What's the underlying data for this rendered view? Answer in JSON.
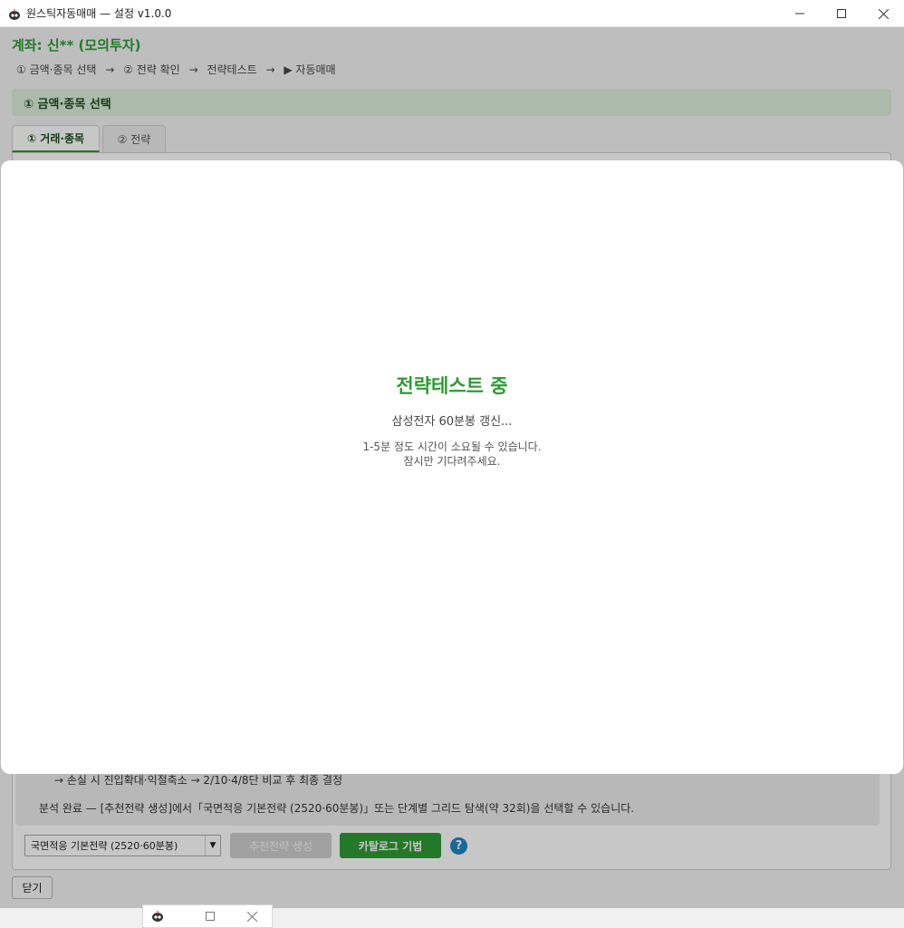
{
  "window": {
    "title": "원스틱자동매매 — 설정 v1.0.0"
  },
  "header": {
    "account": "계좌: 신** (모의투자)",
    "steps": [
      "① 금액·종목 선택",
      "→",
      "② 전략 확인",
      "→",
      "전략테스트",
      "→",
      "▶ 자동매매"
    ]
  },
  "section": {
    "title": "① 금액·종목 선택"
  },
  "tabs": [
    {
      "label": "① 거래·종목",
      "active": true
    },
    {
      "label": "② 전략",
      "active": false
    }
  ],
  "panel": {
    "info_line_1": "→ 손실 시 진입확대·익절축소 → 2/10·4/8단 비교 후 최종 결정",
    "info_line_2": "분석 완료 — [추천전략 생성]에서「국면적응 기본전략 (2520·60분봉)」또는 단계별 그리드 탐색(약 32회)을 선택할 수 있습니다.",
    "strategy_select": "국면적응 기본전략 (2520·60분봉)",
    "recommend_button": "추천전략 생성",
    "catalog_button": "카탈로그 기법",
    "help_label": "?",
    "close_button": "닫기"
  },
  "modal": {
    "title": "전략테스트 중",
    "status": "삼성전자 60분봉 갱신...",
    "note_line_1": "1-5분 정도 시간이 소요될 수 있습니다.",
    "note_line_2": "잠시만 기다려주세요."
  },
  "colors": {
    "accent_green": "#2e9b32",
    "banner_bg": "#dcefdc",
    "help_blue": "#1f86c7"
  },
  "icons": [
    "app-robot-icon",
    "minimize-icon",
    "maximize-icon",
    "close-icon",
    "dropdown-caret-icon",
    "help-icon"
  ]
}
